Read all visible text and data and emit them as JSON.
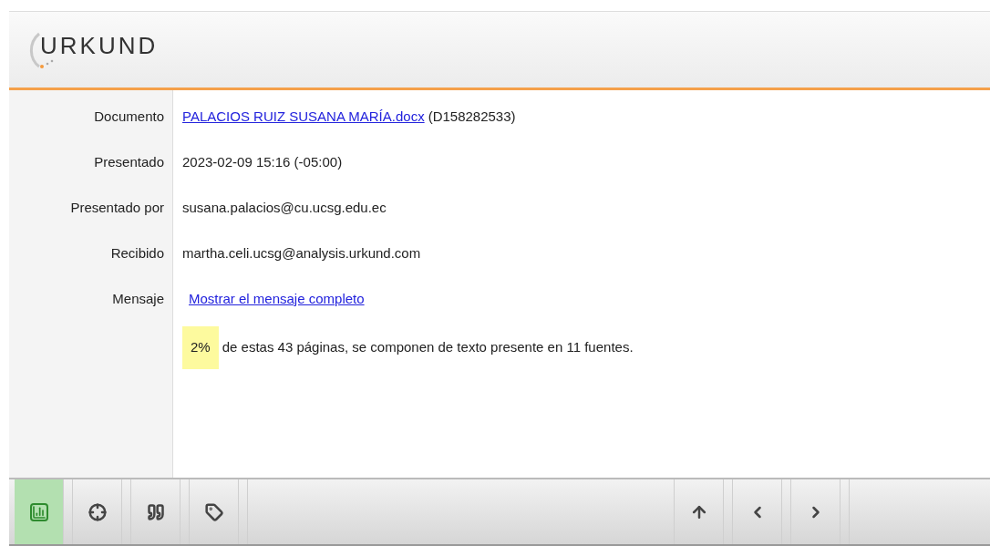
{
  "logo": {
    "text": "URKUND"
  },
  "details": [
    {
      "kind": "link",
      "label": "Documento",
      "link": "PALACIOS RUIZ SUSANA MARÍA.docx",
      "value": "(D158282533)"
    },
    {
      "kind": "text",
      "label": "Presentado",
      "value": "2023-02-09 15:16 (-05:00)"
    },
    {
      "kind": "text",
      "label": "Presentado por",
      "value": "susana.palacios@cu.ucsg.edu.ec"
    },
    {
      "kind": "text",
      "label": "Recibido",
      "value": "martha.celi.ucsg@analysis.urkund.com"
    },
    {
      "kind": "link",
      "label": "Mensaje",
      "link": "Mostrar el mensaje completo"
    }
  ],
  "summary": {
    "percent": "2%",
    "text": "de estas 43 páginas, se componen de texto presente en 11 fuentes."
  },
  "toolbar": {
    "left": [
      {
        "kind": "chart",
        "selected": true
      },
      {
        "kind": "target",
        "selected": false
      },
      {
        "kind": "quote",
        "selected": false
      },
      {
        "kind": "tag",
        "selected": false
      }
    ],
    "right": [
      {
        "kind": "up",
        "selected": false
      },
      {
        "kind": "prev",
        "selected": false
      },
      {
        "kind": "next",
        "selected": false
      }
    ]
  }
}
